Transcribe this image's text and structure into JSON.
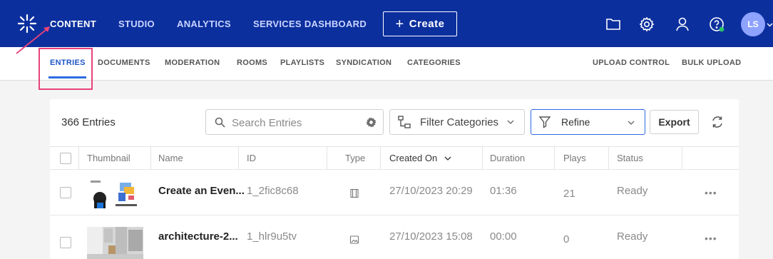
{
  "header": {
    "nav": [
      {
        "label": "CONTENT",
        "active": true
      },
      {
        "label": "STUDIO"
      },
      {
        "label": "ANALYTICS"
      },
      {
        "label": "SERVICES DASHBOARD"
      }
    ],
    "create_label": "Create",
    "avatar_initials": "LS",
    "icons": [
      "folder-icon",
      "gear-icon",
      "user-icon",
      "help-icon"
    ],
    "brand_color": "#0c2f9e"
  },
  "subnav": {
    "items": [
      "ENTRIES",
      "DOCUMENTS",
      "MODERATION",
      "ROOMS",
      "PLAYLISTS",
      "SYNDICATION",
      "CATEGORIES"
    ],
    "active": "ENTRIES",
    "right_items": [
      "UPLOAD CONTROL",
      "BULK UPLOAD"
    ],
    "highlight_color": "#e8437a"
  },
  "toolbar": {
    "count_label": "366 Entries",
    "search_placeholder": "Search Entries",
    "filter_label": "Filter Categories",
    "refine_label": "Refine",
    "export_label": "Export"
  },
  "table": {
    "headers": [
      "Thumbnail",
      "Name",
      "ID",
      "Type",
      "Created On",
      "Duration",
      "Plays",
      "Status"
    ],
    "sorted_by": "Created On",
    "rows": [
      {
        "name": "Create an Even...",
        "id": "1_2fic8c68",
        "type": "video",
        "created": "27/10/2023 20:29",
        "duration": "01:36",
        "plays": "21",
        "status": "Ready"
      },
      {
        "name": "architecture-2...",
        "id": "1_hlr9u5tv",
        "type": "image",
        "created": "27/10/2023 15:08",
        "duration": "00:00",
        "plays": "0",
        "status": "Ready"
      }
    ],
    "more_label": "•••"
  }
}
